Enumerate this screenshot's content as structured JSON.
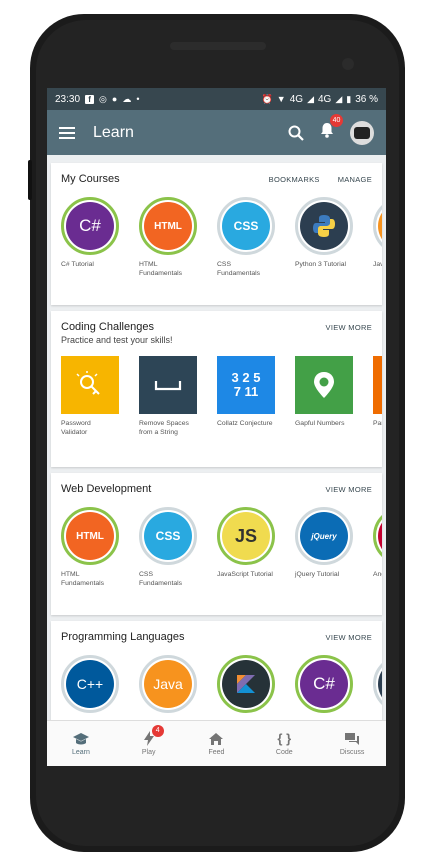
{
  "status_bar": {
    "time": "23:30",
    "network": "4G",
    "network2": "4G",
    "battery": "36 %"
  },
  "toolbar": {
    "title": "Learn",
    "notification_count": "40"
  },
  "my_courses": {
    "title": "My Courses",
    "actions": [
      "BOOKMARKS",
      "MANAGE"
    ],
    "items": [
      {
        "label": "C# Tutorial",
        "badge": "C#",
        "color": "#6a2c91"
      },
      {
        "label": "HTML Fundamentals",
        "badge": "HTML",
        "color": "#f26522"
      },
      {
        "label": "CSS Fundamentals",
        "badge": "CSS",
        "color": "#29a9e0"
      },
      {
        "label": "Python 3 Tutorial",
        "badge": "py",
        "color": "#2c3e50"
      },
      {
        "label": "Java",
        "badge": "J",
        "color": "#f7931e"
      }
    ]
  },
  "coding_challenges": {
    "title": "Coding Challenges",
    "subtitle": "Practice and test your skills!",
    "action": "VIEW MORE",
    "items": [
      {
        "label": "Password Validator",
        "color": "#f7b500"
      },
      {
        "label": "Remove Spaces from a String",
        "color": "#2d4556"
      },
      {
        "label": "Collatz Conjecture",
        "color": "#1e88e5",
        "glyph": "3 2 5 7 11"
      },
      {
        "label": "Gapful Numbers",
        "color": "#43a047"
      },
      {
        "label": "Para",
        "color": "#ef6c00"
      }
    ]
  },
  "web_development": {
    "title": "Web Development",
    "action": "VIEW MORE",
    "items": [
      {
        "label": "HTML Fundamentals",
        "badge": "HTML",
        "color": "#f26522"
      },
      {
        "label": "CSS Fundamentals",
        "badge": "CSS",
        "color": "#29a9e0"
      },
      {
        "label": "JavaScript Tutorial",
        "badge": "JS",
        "color": "#f0db4f"
      },
      {
        "label": "jQuery Tutorial",
        "badge": "jQuery",
        "color": "#0b6cb5"
      },
      {
        "label": "Angu",
        "badge": "A",
        "color": "#c3002f"
      }
    ]
  },
  "programming_languages": {
    "title": "Programming Languages",
    "action": "VIEW MORE",
    "items": [
      {
        "badge": "C++",
        "color": "#00599c"
      },
      {
        "badge": "Java",
        "color": "#f7931e"
      },
      {
        "badge": "K",
        "color": "#263238"
      },
      {
        "badge": "C#",
        "color": "#6a2c91"
      },
      {
        "badge": "",
        "color": "#2c3e50"
      }
    ]
  },
  "bottom_nav": [
    {
      "label": "Learn",
      "active": true
    },
    {
      "label": "Play",
      "badge": "4"
    },
    {
      "label": "Feed"
    },
    {
      "label": "Code",
      "glyph": "{ }"
    },
    {
      "label": "Discuss"
    }
  ]
}
